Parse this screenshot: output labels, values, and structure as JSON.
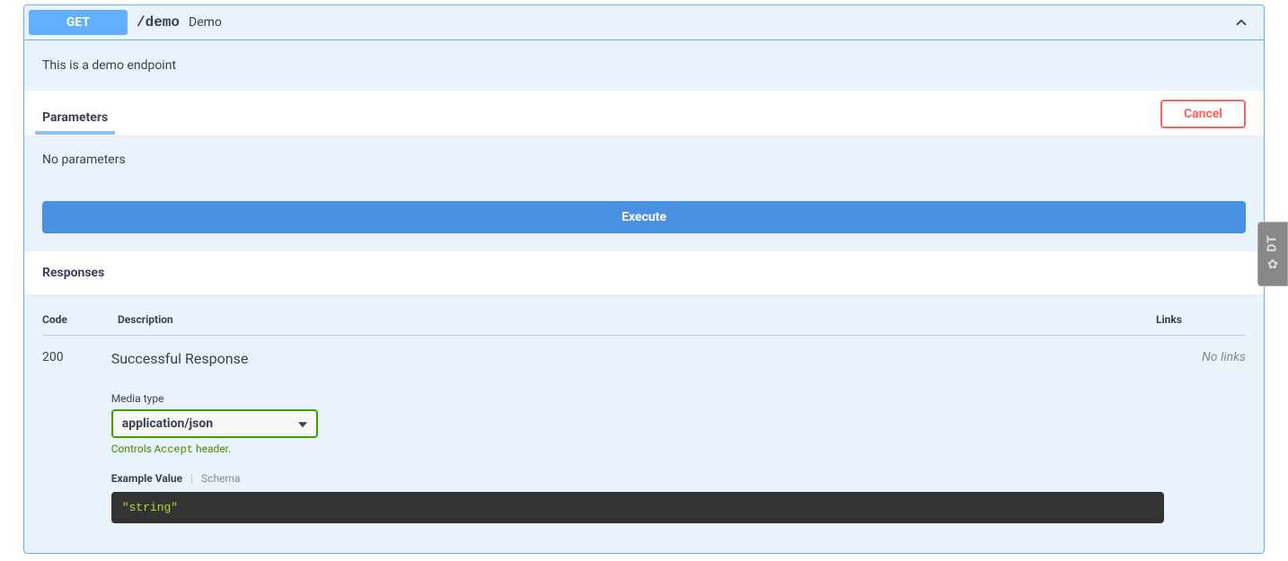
{
  "method": "GET",
  "path": "/demo",
  "summary": "Demo",
  "description": "This is a demo endpoint",
  "parameters": {
    "tab_label": "Parameters",
    "cancel_label": "Cancel",
    "empty_text": "No parameters"
  },
  "execute_label": "Execute",
  "responses": {
    "header": "Responses",
    "cols": {
      "code": "Code",
      "description": "Description",
      "links": "Links"
    },
    "row": {
      "code": "200",
      "description": "Successful Response",
      "links": "No links"
    },
    "media_type_label": "Media type",
    "media_type_value": "application/json",
    "controls_prefix": "Controls ",
    "controls_mono": "Accept",
    "controls_suffix": " header.",
    "example_tabs": {
      "example": "Example Value",
      "schema": "Schema"
    },
    "example_body": "\"string\""
  },
  "side_badge": "DT"
}
